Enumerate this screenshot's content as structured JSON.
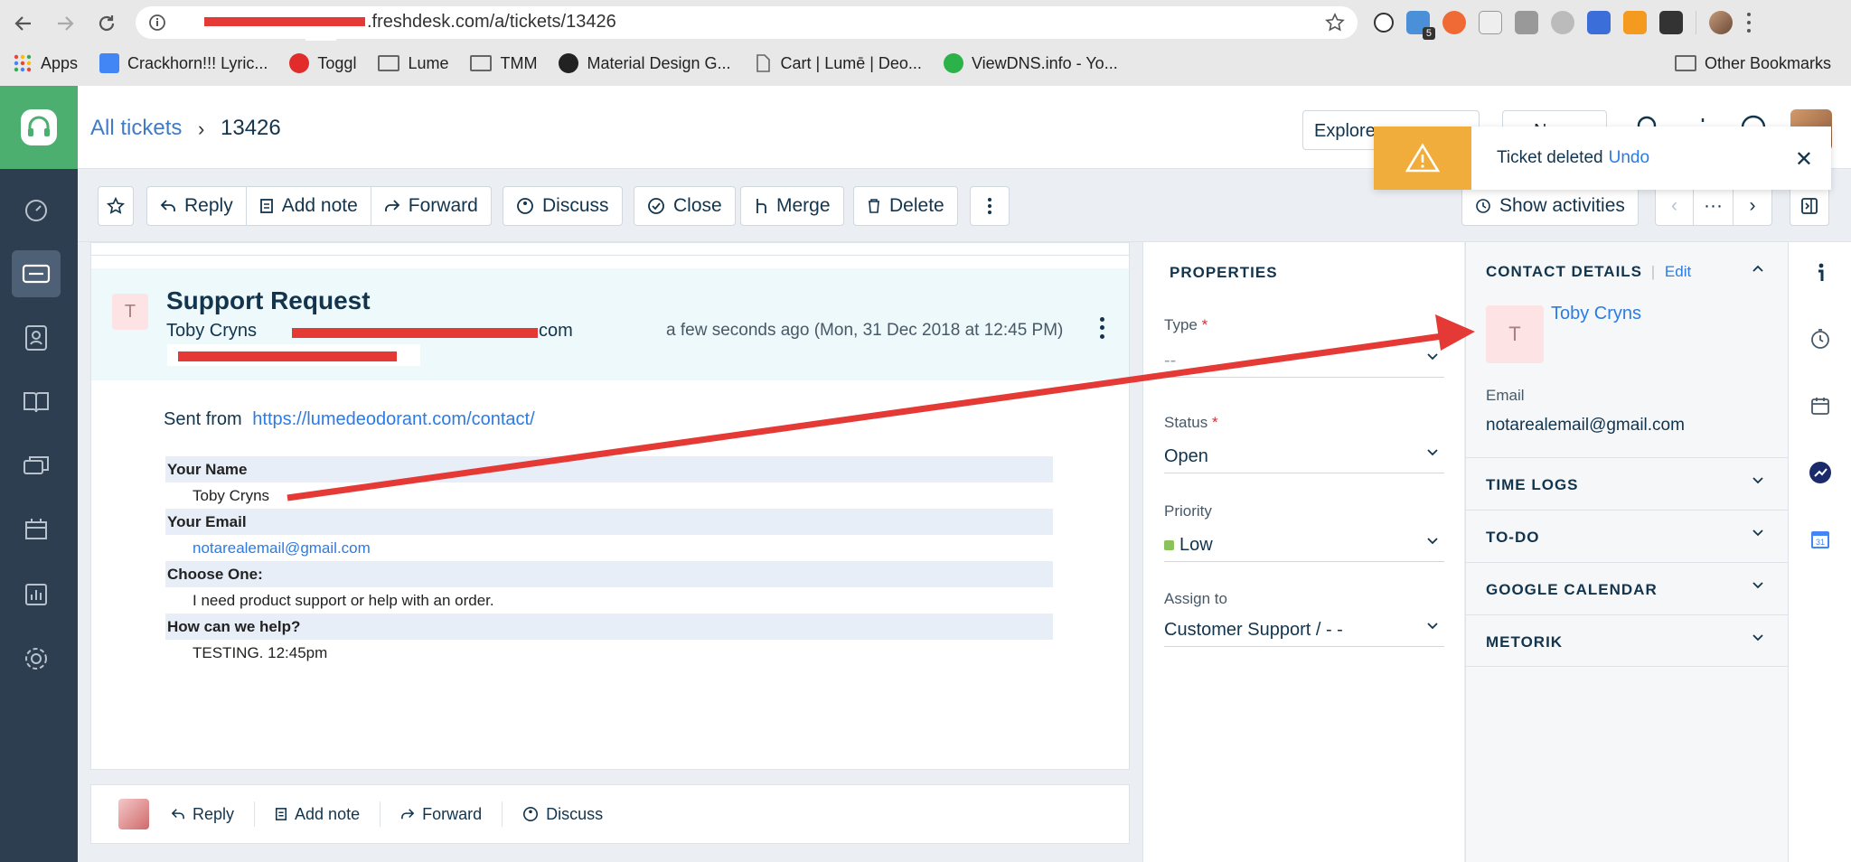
{
  "browser": {
    "url_text": ".freshdesk.com/a/tickets/13426",
    "bookmarks": [
      "Apps",
      "Crackhorn!!! Lyric...",
      "Toggl",
      "Lume",
      "TMM",
      "Material Design G...",
      "Cart | Lumē | Deo...",
      "ViewDNS.info - Yo..."
    ],
    "other_bookmarks": "Other Bookmarks",
    "ext_badge": "5"
  },
  "header": {
    "breadcrumb_all": "All tickets",
    "breadcrumb_sep": "›",
    "ticket_id": "13426",
    "explore_label": "Explore",
    "new_label": "N"
  },
  "toast": {
    "message": "Ticket deleted",
    "undo": "Undo",
    "close": "✕"
  },
  "toolbar": {
    "reply": "Reply",
    "add_note": "Add note",
    "forward": "Forward",
    "discuss": "Discuss",
    "close": "Close",
    "merge": "Merge",
    "delete": "Delete",
    "show_activities": "Show activities",
    "more": "···"
  },
  "message": {
    "avatar_letter": "T",
    "subject": "Support Request",
    "from_name": "Toby Cryns",
    "from_tail": "com",
    "time": "a few seconds ago (Mon, 31 Dec 2018 at 12:45 PM)",
    "sent_from_label": "Sent from",
    "sent_from_link": "https://lumedeodorant.com/contact/",
    "fields": [
      {
        "label": "Your Name",
        "value": "Toby Cryns",
        "link": false
      },
      {
        "label": "Your Email",
        "value": "notarealemail@gmail.com",
        "link": true
      },
      {
        "label": "Choose One:",
        "value": "I need product support or help with an order.",
        "link": false
      },
      {
        "label": "How can we help?",
        "value": "TESTING. 12:45pm",
        "link": false
      }
    ]
  },
  "replybar": {
    "reply": "Reply",
    "add_note": "Add note",
    "forward": "Forward",
    "discuss": "Discuss"
  },
  "properties": {
    "title": "PROPERTIES",
    "type_label": "Type",
    "type_value": "--",
    "status_label": "Status",
    "status_value": "Open",
    "priority_label": "Priority",
    "priority_value": "Low",
    "assign_label": "Assign to",
    "assign_value": "Customer Support / - -",
    "required_mark": "*"
  },
  "contact": {
    "title": "CONTACT DETAILS",
    "divider": "|",
    "edit": "Edit",
    "avatar_letter": "T",
    "name": "Toby Cryns",
    "email_label": "Email",
    "email": "notarealemail@gmail.com",
    "sections": [
      "TIME LOGS",
      "TO-DO",
      "GOOGLE CALENDAR",
      "METORIK"
    ]
  },
  "colors": {
    "nav_bg": "#2c3e50",
    "logo_green": "#4caf70",
    "link_blue": "#2c7be5",
    "toast_warning": "#f0ad3c",
    "annotation_red": "#e53935"
  }
}
